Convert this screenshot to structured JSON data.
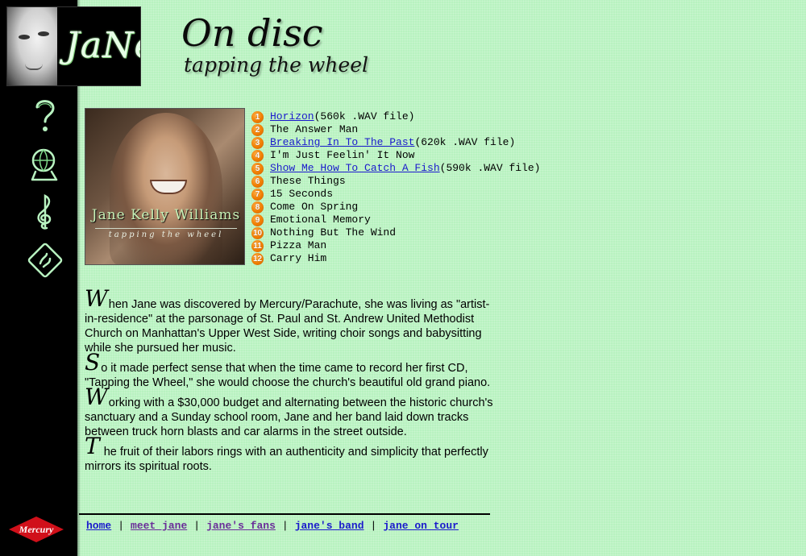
{
  "header": {
    "title": "On disc",
    "subtitle": "tapping the wheel",
    "logo_text": "JaNe"
  },
  "sidebar": {
    "icons": [
      "question-icon",
      "globe-person-icon",
      "treble-clef-icon",
      "diamond-swirl-icon"
    ],
    "label_logo": "Mercury"
  },
  "album": {
    "artist": "Jane Kelly Williams",
    "title": "tapping the wheel"
  },
  "tracks": [
    {
      "num": "1",
      "title": "Horizon",
      "link": true,
      "suffix": "(560k .WAV file)"
    },
    {
      "num": "2",
      "title": "The Answer Man",
      "link": false,
      "suffix": ""
    },
    {
      "num": "3",
      "title": "Breaking In To The Past",
      "link": true,
      "suffix": "(620k .WAV file)"
    },
    {
      "num": "4",
      "title": "I'm Just Feelin' It Now",
      "link": false,
      "suffix": ""
    },
    {
      "num": "5",
      "title": "Show Me How To Catch A Fish",
      "link": true,
      "suffix": "(590k .WAV file)"
    },
    {
      "num": "6",
      "title": "These Things",
      "link": false,
      "suffix": ""
    },
    {
      "num": "7",
      "title": "15 Seconds",
      "link": false,
      "suffix": ""
    },
    {
      "num": "8",
      "title": "Come On Spring",
      "link": false,
      "suffix": ""
    },
    {
      "num": "9",
      "title": "Emotional Memory",
      "link": false,
      "suffix": ""
    },
    {
      "num": "10",
      "title": "Nothing But The Wind",
      "link": false,
      "suffix": ""
    },
    {
      "num": "11",
      "title": "Pizza Man",
      "link": false,
      "suffix": ""
    },
    {
      "num": "12",
      "title": "Carry Him",
      "link": false,
      "suffix": ""
    }
  ],
  "article": {
    "paragraphs": [
      {
        "cap": "W",
        "text": "hen Jane was discovered by Mercury/Parachute, she was living as \"artist-in-residence\" at the parsonage of St. Paul and St. Andrew United Methodist Church on Manhattan's Upper West Side, writing choir songs and babysitting while she pursued her music."
      },
      {
        "cap": "S",
        "text": "o it made perfect sense that when the time came to record her first CD, \"Tapping the Wheel,\" she would choose the church's beautiful old grand piano."
      },
      {
        "cap": "W",
        "text": "orking with a $30,000 budget and alternating between the historic church's sanctuary and a Sunday school room, Jane and her band laid down tracks between truck horn blasts and car alarms in the street outside."
      },
      {
        "cap": "T",
        "text": " he fruit of their labors rings with an authenticity and simplicity that perfectly mirrors its spiritual roots."
      }
    ]
  },
  "footer": {
    "links": [
      {
        "label": "home",
        "visited": false
      },
      {
        "label": "meet jane",
        "visited": true
      },
      {
        "label": "jane's fans",
        "visited": true
      },
      {
        "label": "jane's band",
        "visited": false
      },
      {
        "label": "jane on tour",
        "visited": false
      }
    ]
  },
  "colors": {
    "background": "#b8f2c0",
    "sidebar": "#000000",
    "link": "#1a1acc",
    "visited_link": "#6a2d99",
    "track_badge": "#f07d00",
    "mercury_red": "#d0101a"
  }
}
